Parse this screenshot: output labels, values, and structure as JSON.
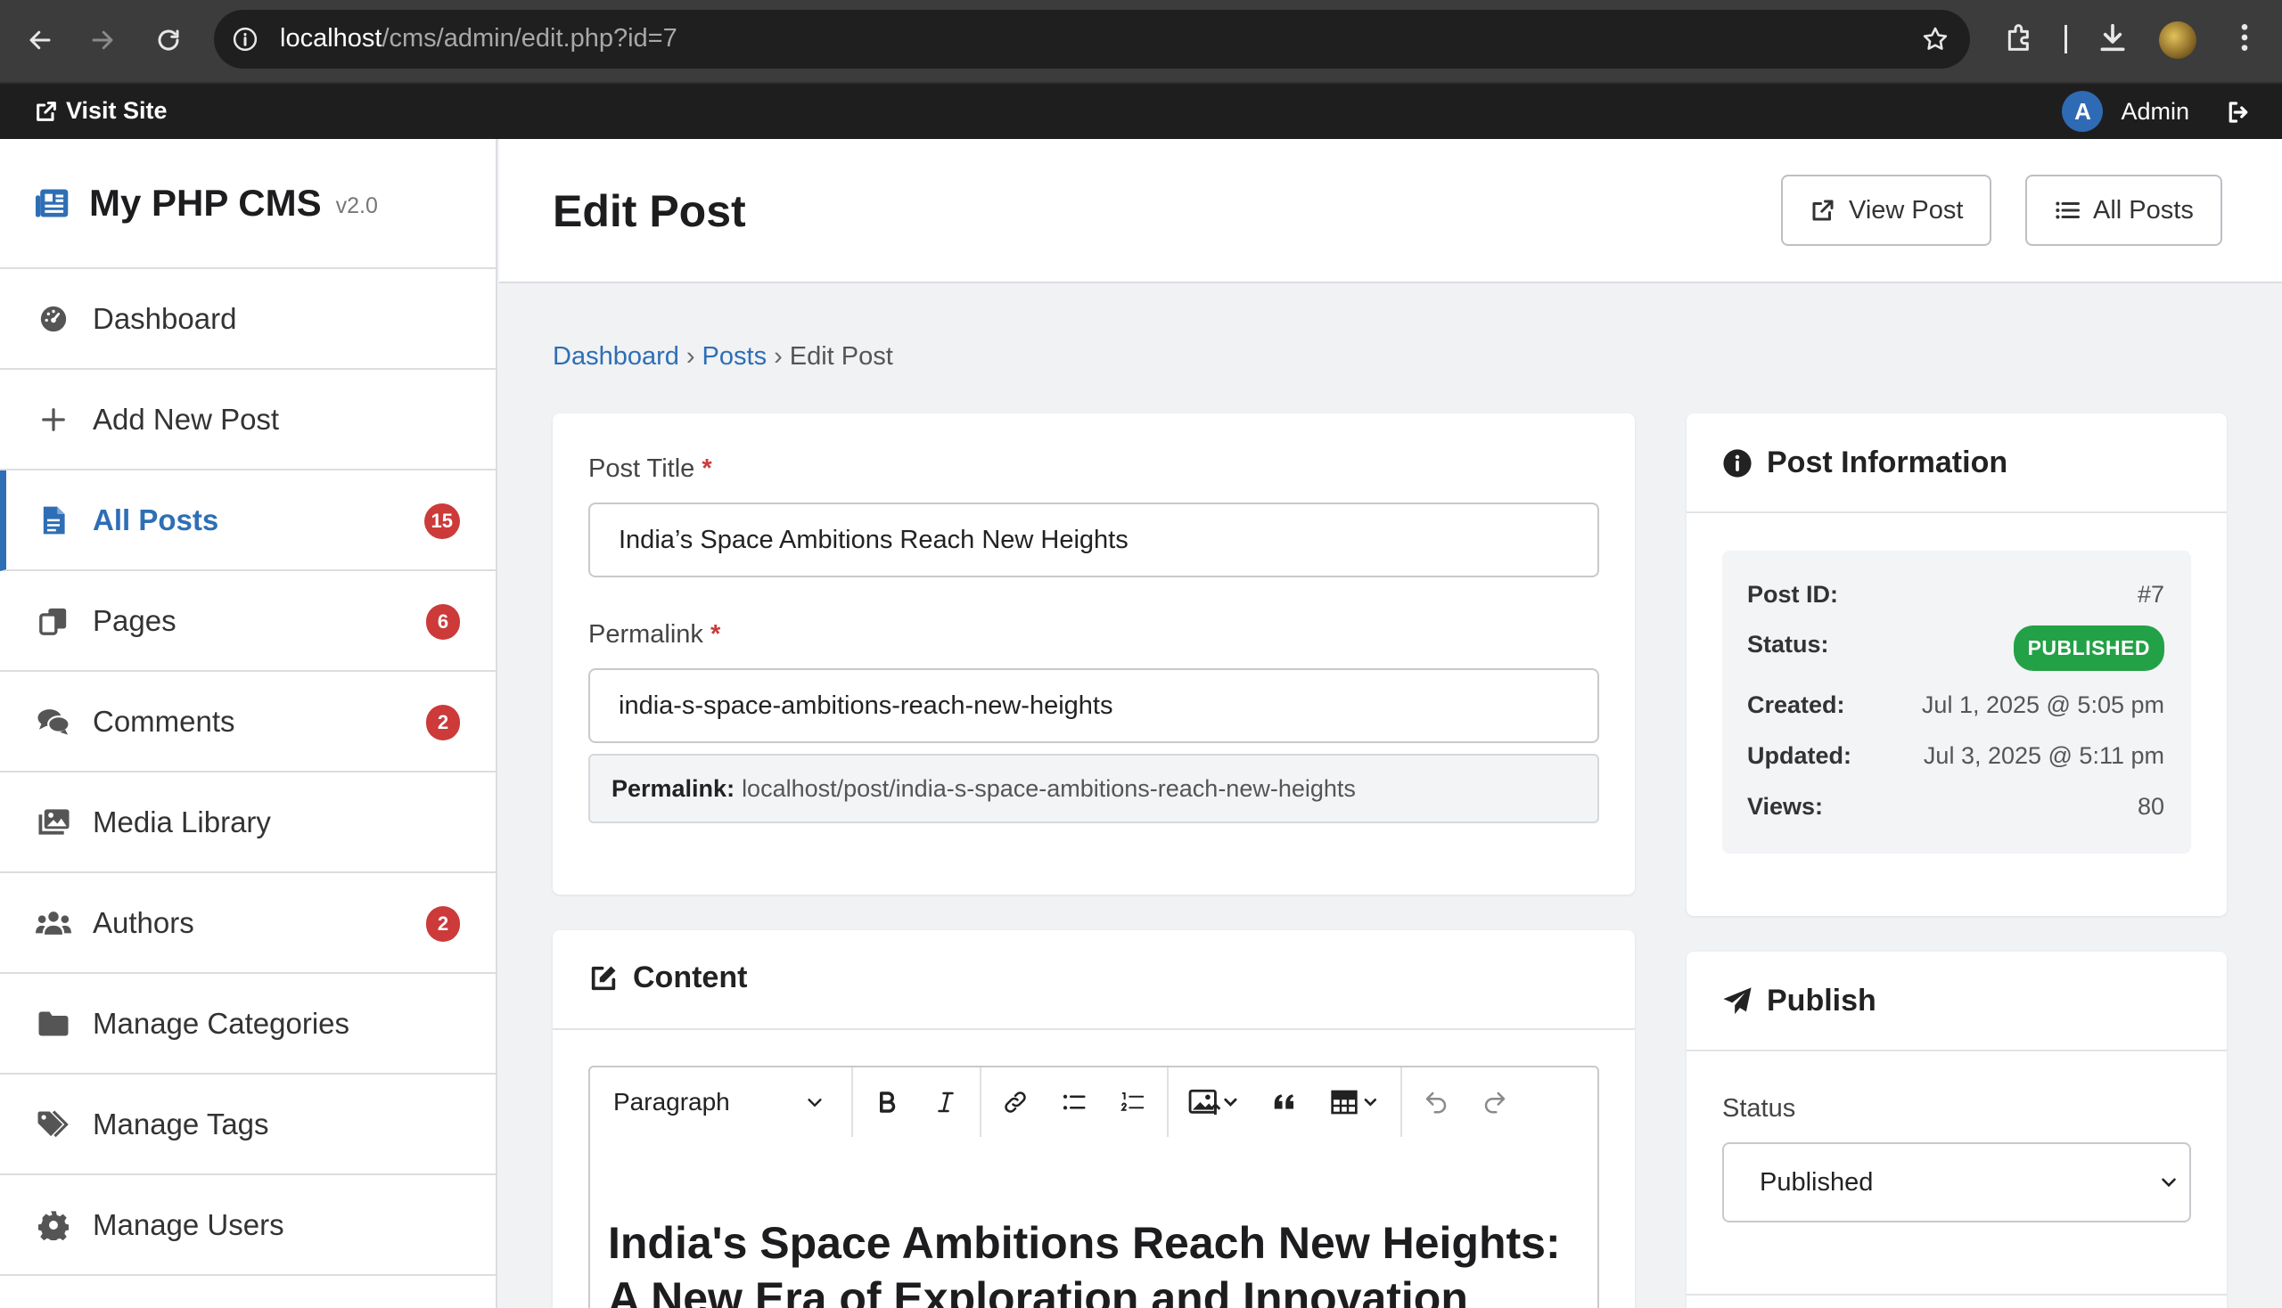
{
  "browser": {
    "url_host": "localhost",
    "url_path": "/cms/admin/edit.php?id=7"
  },
  "adminbar": {
    "visit_site": "Visit Site",
    "user_initial": "A",
    "user_name": "Admin"
  },
  "sidebar": {
    "brand": "My PHP CMS",
    "version": "v2.0",
    "items": [
      {
        "label": "Dashboard",
        "icon": "gauge-icon",
        "badge": null
      },
      {
        "label": "Add New Post",
        "icon": "plus-icon",
        "badge": null
      },
      {
        "label": "All Posts",
        "icon": "file-icon",
        "badge": "15",
        "active": true
      },
      {
        "label": "Pages",
        "icon": "copy-icon",
        "badge": "6"
      },
      {
        "label": "Comments",
        "icon": "comments-icon",
        "badge": "2"
      },
      {
        "label": "Media Library",
        "icon": "images-icon",
        "badge": null
      },
      {
        "label": "Authors",
        "icon": "users-icon",
        "badge": "2"
      },
      {
        "label": "Manage Categories",
        "icon": "folder-icon",
        "badge": null
      },
      {
        "label": "Manage Tags",
        "icon": "tags-icon",
        "badge": null
      },
      {
        "label": "Manage Users",
        "icon": "gear-icon",
        "badge": null
      }
    ]
  },
  "header": {
    "title": "Edit Post",
    "view_post": "View Post",
    "all_posts": "All Posts"
  },
  "breadcrumb": {
    "home": "Dashboard",
    "posts": "Posts",
    "current": "Edit Post",
    "separator": "›"
  },
  "form": {
    "title_label": "Post Title",
    "title_value": "India’s Space Ambitions Reach New Heights",
    "permalink_label": "Permalink",
    "permalink_value": "india-s-space-ambitions-reach-new-heights",
    "permalink_preview_label": "Permalink:",
    "permalink_preview": "localhost/post/india-s-space-ambitions-reach-new-heights",
    "required_mark": "*"
  },
  "content": {
    "title": "Content",
    "format_select": "Paragraph",
    "editor_heading": "India's Space Ambitions Reach New Heights: A New Era of Exploration and Innovation"
  },
  "post_info": {
    "title": "Post Information",
    "rows": {
      "id_label": "Post ID:",
      "id_value": "#7",
      "status_label": "Status:",
      "status_value": "PUBLISHED",
      "created_label": "Created:",
      "created_value": "Jul 1, 2025 @ 5:05 pm",
      "updated_label": "Updated:",
      "updated_value": "Jul 3, 2025 @ 5:11 pm",
      "views_label": "Views:",
      "views_value": "80"
    }
  },
  "publish": {
    "title": "Publish",
    "status_label": "Status",
    "status_value": "Published"
  },
  "colors": {
    "accent": "#2e6eb5",
    "badge": "#cc3a3a",
    "published": "#23a147",
    "adminbar": "#1e1e1e"
  }
}
